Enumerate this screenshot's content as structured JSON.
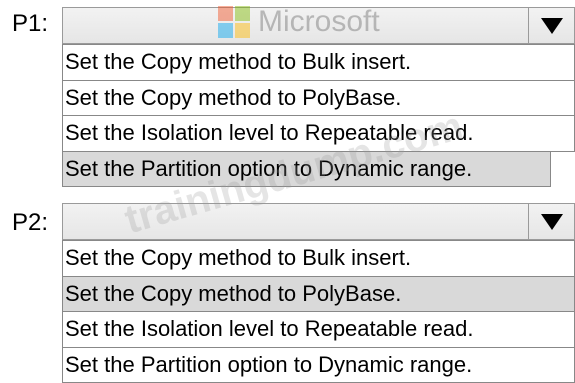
{
  "p1": {
    "label": "P1:",
    "options": [
      "Set the Copy method to Bulk insert.",
      "Set the Copy method to PolyBase.",
      "Set the Isolation level to Repeatable read.",
      "Set the Partition option to Dynamic range."
    ],
    "selected_index": 3
  },
  "p2": {
    "label": "P2:",
    "options": [
      "Set the Copy method to Bulk insert.",
      "Set the Copy method to PolyBase.",
      "Set the Isolation level to Repeatable read.",
      "Set the Partition option to Dynamic range."
    ],
    "selected_index": 1
  },
  "watermark": {
    "logo_text": "Microsoft",
    "text": "trainingdump.com",
    "logo_colors": [
      "#f25022",
      "#7fba00",
      "#00a4ef",
      "#ffb900"
    ]
  },
  "icons": {
    "dropdown_arrow": "chevron-down-icon",
    "logo": "microsoft-logo-icon"
  }
}
